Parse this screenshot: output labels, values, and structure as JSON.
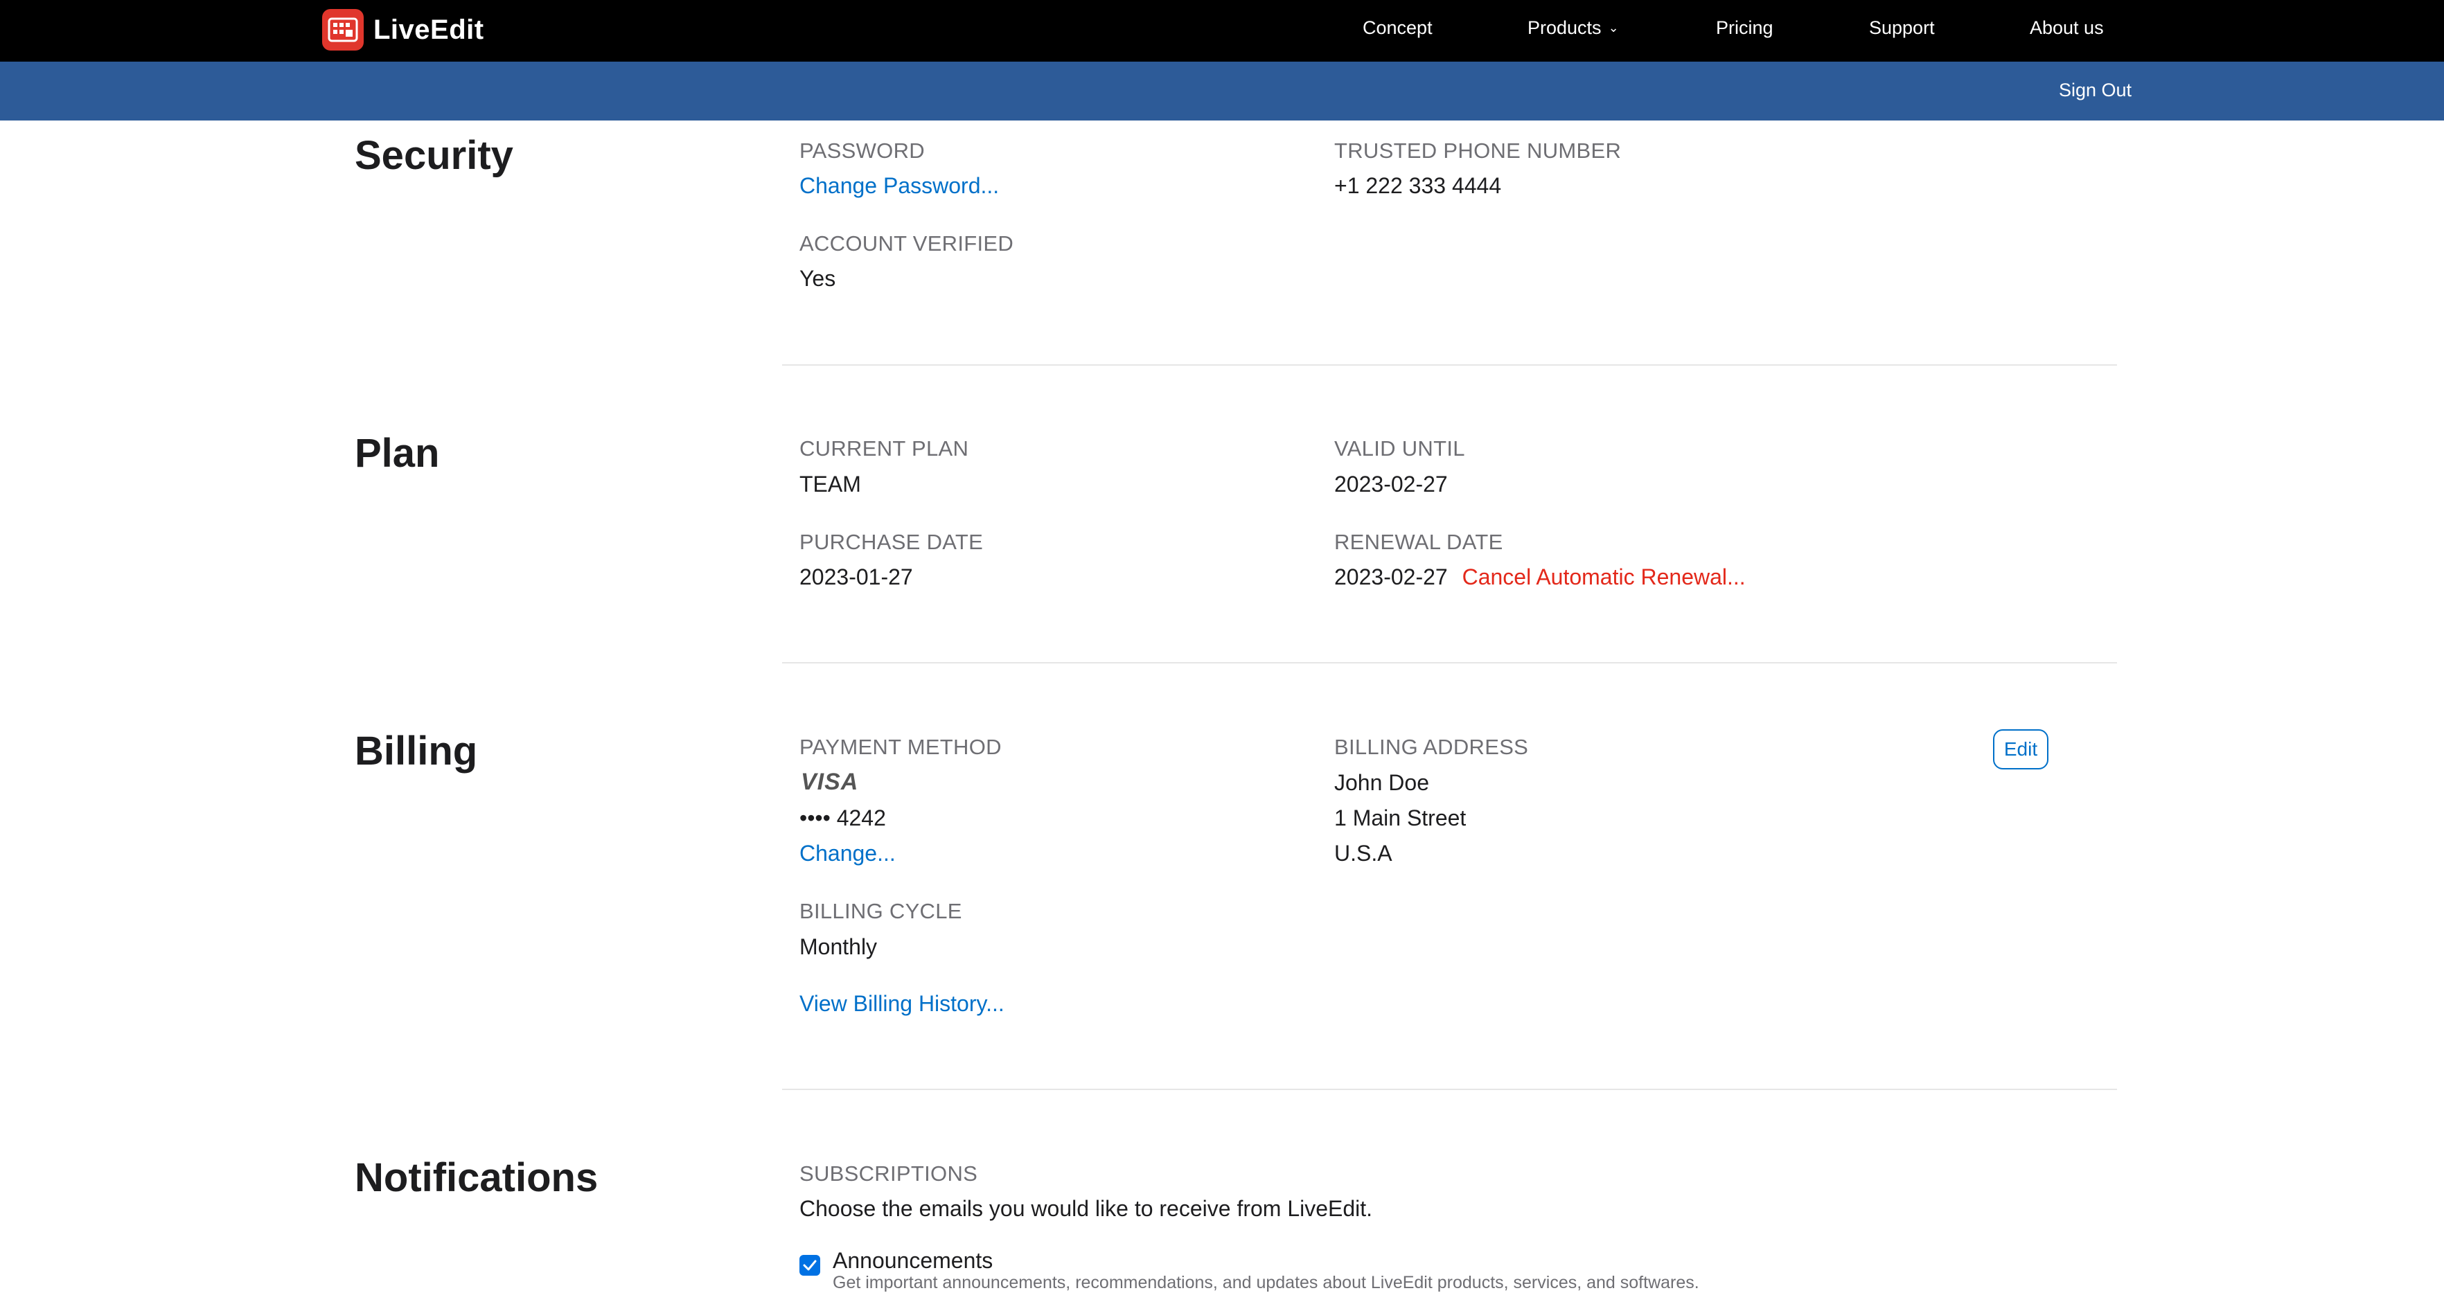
{
  "nav": {
    "logo": "LiveEdit",
    "links": [
      "Concept",
      "Products",
      "Pricing",
      "Support",
      "About us"
    ]
  },
  "subbar": {
    "sign_out": "Sign Out"
  },
  "security": {
    "title": "Security",
    "password_label": "PASSWORD",
    "change_password": "Change Password...",
    "phone_label": "TRUSTED PHONE NUMBER",
    "phone": "+1 222 333 4444",
    "verified_label": "ACCOUNT VERIFIED",
    "verified": "Yes"
  },
  "plan": {
    "title": "Plan",
    "current_label": "CURRENT PLAN",
    "current": "TEAM",
    "valid_label": "VALID UNTIL",
    "valid": "2023-02-27",
    "purchase_label": "PURCHASE DATE",
    "purchase": "2023-01-27",
    "renewal_label": "RENEWAL DATE",
    "renewal": "2023-02-27",
    "cancel_renewal": "Cancel Automatic Renewal..."
  },
  "billing": {
    "title": "Billing",
    "payment_label": "PAYMENT METHOD",
    "card_brand": "VISA",
    "card_number": "•••• 4242",
    "change": "Change...",
    "address_label": "BILLING ADDRESS",
    "address_name": "John Doe",
    "address_street": "1 Main Street",
    "address_country": "U.S.A",
    "edit": "Edit",
    "cycle_label": "BILLING CYCLE",
    "cycle": "Monthly",
    "history": "View Billing History..."
  },
  "notifications": {
    "title": "Notifications",
    "subs_label": "SUBSCRIPTIONS",
    "subs_desc": "Choose the emails you would like to receive from LiveEdit.",
    "announcements": "Announcements",
    "announcements_desc": "Get important announcements, recommendations, and updates about LiveEdit products, services, and softwares."
  }
}
